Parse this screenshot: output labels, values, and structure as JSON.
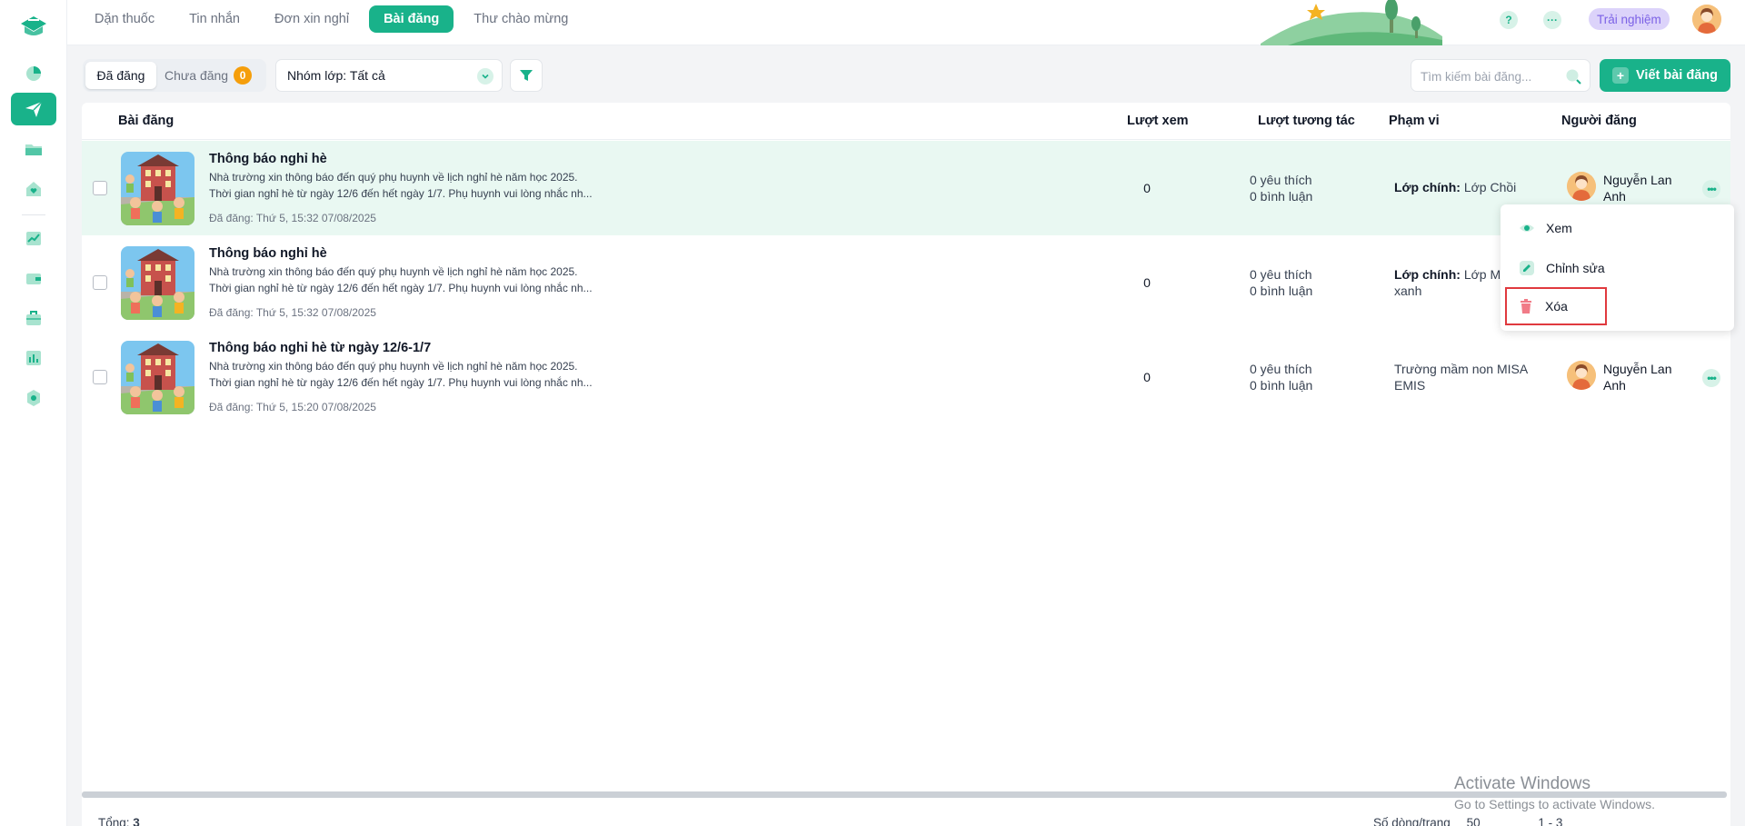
{
  "topnav": {
    "tabs": [
      {
        "label": "Dặn thuốc",
        "active": false
      },
      {
        "label": "Tin nhắn",
        "active": false
      },
      {
        "label": "Đơn xin nghỉ",
        "active": false
      },
      {
        "label": "Bài đăng",
        "active": true
      },
      {
        "label": "Thư chào mừng",
        "active": false
      }
    ],
    "help_label": "?",
    "more_label": "···",
    "trial_label": "Trải nghiệm"
  },
  "sidebar": {
    "items": [
      {
        "icon": "school-logo-icon"
      },
      {
        "icon": "pie-chart-icon"
      },
      {
        "icon": "paper-plane-icon",
        "active": true
      },
      {
        "icon": "folder-icon"
      },
      {
        "icon": "heart-house-icon"
      },
      {
        "icon": "trend-chart-icon"
      },
      {
        "icon": "wallet-icon"
      },
      {
        "icon": "briefcase-icon"
      },
      {
        "icon": "bar-chart-icon"
      },
      {
        "icon": "settings-icon"
      }
    ]
  },
  "toolbar": {
    "posted_label": "Đã đăng",
    "draft_label": "Chưa đăng",
    "draft_count": "0",
    "group_select": "Nhóm lớp: Tất cả",
    "search_placeholder": "Tìm kiếm bài đăng...",
    "write_button": "Viết bài đăng"
  },
  "table": {
    "headers": {
      "post": "Bài đăng",
      "views": "Lượt xem",
      "interactions": "Lượt tương tác",
      "scope": "Phạm vi",
      "poster": "Người đăng"
    },
    "rows": [
      {
        "title": "Thông báo nghỉ hè",
        "line1": "Nhà trường xin thông báo đến quý phụ huynh về lịch nghỉ hè năm học 2025.",
        "line2": "Thời gian nghỉ hè từ ngày 12/6 đến hết ngày 1/7. Phụ huynh vui lòng nhắc nh...",
        "date": "Đã đăng: Thứ 5, 15:32 07/08/2025",
        "views": "0",
        "likes": "0 yêu thích",
        "comments": "0 bình luận",
        "scope_label": "Lớp chính:",
        "scope_value": "Lớp Chồi",
        "poster": "Nguyễn Lan Anh",
        "highlight": true
      },
      {
        "title": "Thông báo nghỉ hè",
        "line1": "Nhà trường xin thông báo đến quý phụ huynh về lịch nghỉ hè năm học 2025.",
        "line2": "Thời gian nghỉ hè từ ngày 12/6 đến hết ngày 1/7. Phụ huynh vui lòng nhắc nh...",
        "date": "Đã đăng: Thứ 5, 15:32 07/08/2025",
        "views": "0",
        "likes": "0 yêu thích",
        "comments": "0 bình luận",
        "scope_label": "Lớp chính:",
        "scope_value": "Lớp M",
        "scope_value2": "xanh",
        "poster": "",
        "highlight": false
      },
      {
        "title": "Thông báo nghỉ hè từ ngày 12/6-1/7",
        "line1": "Nhà trường xin thông báo đến quý phụ huynh về lịch nghỉ hè năm học 2025.",
        "line2": "Thời gian nghỉ hè từ ngày 12/6 đến hết ngày 1/7. Phụ huynh vui lòng nhắc nh...",
        "date": "Đã đăng: Thứ 5, 15:20 07/08/2025",
        "views": "0",
        "likes": "0 yêu thích",
        "comments": "0 bình luận",
        "scope_value": "Trường mầm non MISA EMIS",
        "poster": "Nguyễn Lan Anh",
        "highlight": false
      }
    ]
  },
  "context_menu": {
    "view": "Xem",
    "edit": "Chỉnh sửa",
    "delete": "Xóa"
  },
  "footer": {
    "total_label": "Tổng:",
    "total_value": "3",
    "rows_per_page_label": "Số dòng/trang",
    "rows_per_page_value": "50",
    "range": "1 - 3"
  },
  "watermark": {
    "title": "Activate Windows",
    "subtitle": "Go to Settings to activate Windows."
  },
  "colors": {
    "accent": "#19b28a",
    "accent_light": "#d7f2e8",
    "row_highlight": "#e9f8f2",
    "badge": "#f59e0b",
    "trial_bg": "#dcd3fa",
    "delete_outline": "#e0393e",
    "delete_icon": "#f17b87"
  }
}
